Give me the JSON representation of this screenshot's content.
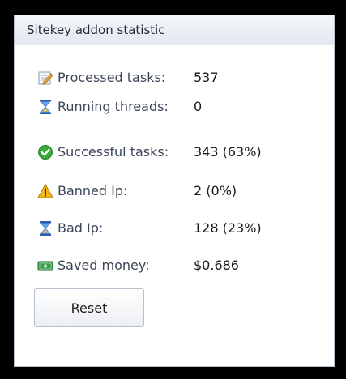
{
  "panel": {
    "title": "Sitekey addon statistic"
  },
  "stats": [
    {
      "icon": "edit-note-icon",
      "label": "Processed tasks:",
      "value": "537"
    },
    {
      "icon": "hourglass-icon",
      "label": "Running threads:",
      "value": "0"
    },
    {
      "icon": "check-circle-icon",
      "label": "Successful tasks:",
      "value": "343 (63%)"
    },
    {
      "icon": "warning-icon",
      "label": "Banned Ip:",
      "value": "2 (0%)"
    },
    {
      "icon": "hourglass-icon",
      "label": "Bad Ip:",
      "value": "128 (23%)"
    },
    {
      "icon": "money-icon",
      "label": "Saved money:",
      "value": "$0.686"
    }
  ],
  "actions": {
    "reset_label": "Reset"
  },
  "colors": {
    "hourglass": "#3a78d4",
    "success": "#3aa93a",
    "warning": "#f2b51a",
    "money": "#3d9b50"
  }
}
